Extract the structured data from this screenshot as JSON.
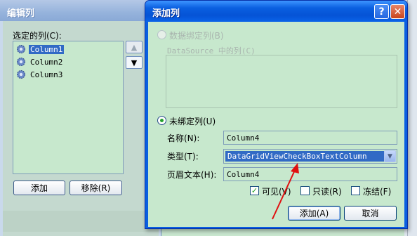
{
  "edit_columns_window": {
    "title": "编辑列",
    "selected_columns_label": "选定的列(C):",
    "columns": [
      "Column1",
      "Column2",
      "Column3"
    ],
    "selected_column": "Column1",
    "move_up_icon": "arrow-up-icon",
    "move_down_icon": "arrow-down-icon",
    "add_button": "添加",
    "remove_button": "移除(R)"
  },
  "add_column_dialog": {
    "title": "添加列",
    "help_button": "?",
    "close_button": "✕",
    "databound_radio": "数据绑定列(B)",
    "datasource_columns_label": "DataSource 中的列(C)",
    "unbound_radio": "未绑定列(U)",
    "name_label": "名称(N):",
    "name_value": "Column4",
    "type_label": "类型(T):",
    "type_value": "DataGridViewCheckBoxTextColumn",
    "header_label": "页眉文本(H):",
    "header_value": "Column4",
    "visible_label": "可见(V)",
    "visible_checked": true,
    "readonly_label": "只读(R)",
    "readonly_checked": false,
    "frozen_label": "冻结(F)",
    "frozen_checked": false,
    "add_button": "添加(A)",
    "cancel_button": "取消"
  },
  "colors": {
    "dialog_frame": "#0a5fe0",
    "client_background": "#c7e8cd",
    "selection": "#316ac5",
    "annotation_arrow": "#e01010"
  }
}
